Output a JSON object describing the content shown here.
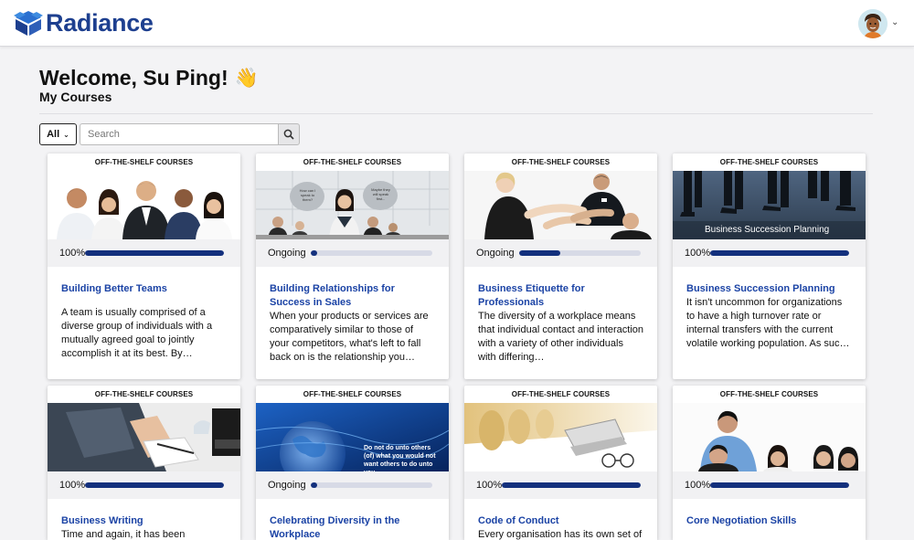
{
  "app": {
    "name": "Radiance"
  },
  "header": {
    "welcome": "Welcome, Su Ping!",
    "wave": "👋",
    "subtitle": "My Courses"
  },
  "filter": {
    "selected": "All"
  },
  "search": {
    "placeholder": "Search"
  },
  "courses": [
    {
      "tag": "OFF-THE-SHELF COURSES",
      "status": "100%",
      "progress": 1.0,
      "title": "Building Better Teams",
      "description": "A team is usually comprised of a diverse group of individuals with a mutually agreed goal to jointly accomplish it at its best. By…"
    },
    {
      "tag": "OFF-THE-SHELF COURSES",
      "status": "Ongoing",
      "progress": 0.05,
      "title": "Building Relationships for Success in Sales",
      "description": "When your products or services are comparatively similar to those of your competitors, what's left to fall back on is the relationship you…",
      "image_text": [
        "How can I speak to them?",
        "Maybe they will speak first..."
      ]
    },
    {
      "tag": "OFF-THE-SHELF COURSES",
      "status": "Ongoing",
      "progress": 0.34,
      "title": "Business Etiquette for Professionals",
      "description": "The diversity of a workplace means that individual contact and interaction with a variety of other individuals with differing…"
    },
    {
      "tag": "OFF-THE-SHELF COURSES",
      "status": "100%",
      "progress": 1.0,
      "title": "Business Succession Planning",
      "description": "It isn't uncommon for organizations to have a high turnover rate or internal transfers with the current volatile working population. As suc…",
      "image_text": "Business Succession Planning"
    },
    {
      "tag": "OFF-THE-SHELF COURSES",
      "status": "100%",
      "progress": 1.0,
      "title": "Business Writing",
      "description": "Time and again, it has been"
    },
    {
      "tag": "OFF-THE-SHELF COURSES",
      "status": "Ongoing",
      "progress": 0.05,
      "title": "Celebrating Diversity in the Workplace",
      "description": "",
      "image_text": "Do not do unto others (of) what you would not want others to do unto you."
    },
    {
      "tag": "OFF-THE-SHELF COURSES",
      "status": "100%",
      "progress": 1.0,
      "title": "Code of Conduct",
      "description": "Every organisation has its own set of"
    },
    {
      "tag": "OFF-THE-SHELF COURSES",
      "status": "100%",
      "progress": 1.0,
      "title": "Core Negotiation Skills",
      "description": ""
    }
  ],
  "colors": {
    "brand": "#1d3f8f",
    "link": "#1b43a5",
    "progress": "#13307d",
    "track": "#d7dae6"
  }
}
